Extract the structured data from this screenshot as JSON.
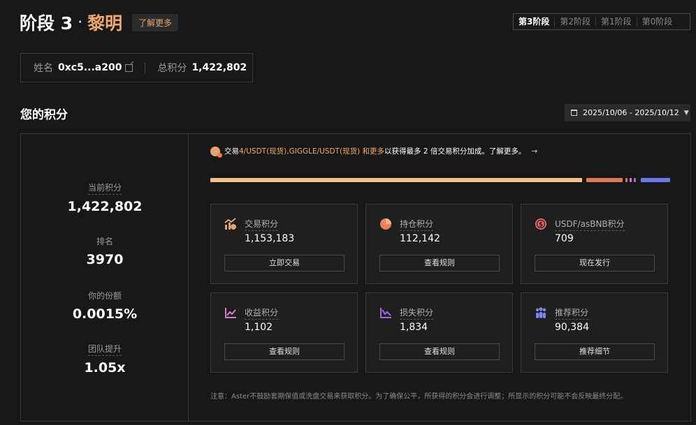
{
  "header": {
    "stage_title": "阶段 3",
    "dot": "·",
    "stage_name": "黎明",
    "learn_more": "了解更多",
    "stage_tabs": [
      "第3阶段",
      "第2阶段",
      "第1阶段",
      "第0阶段"
    ]
  },
  "user": {
    "name_label": "姓名",
    "name_value": "0xc5...a200",
    "total_label": "总积分",
    "total_value": "1,422,802"
  },
  "section": {
    "title": "您的积分",
    "date_range": "2025/10/06 - 2025/10/12"
  },
  "stats": [
    {
      "label": "当前积分",
      "value": "1,422,802"
    },
    {
      "label": "排名",
      "value": "3970"
    },
    {
      "label": "你的份额",
      "value": "0.0015%"
    },
    {
      "label": "团队提升",
      "value": "1.05x"
    }
  ],
  "promo": {
    "pre": "交易",
    "highlight": "4/USDT(现货),GIGGLE/USDT(现货) 和更多",
    "post": "以获得最多 2 倍交易积分加成。了解更多。",
    "arrow": "→"
  },
  "progress": {
    "segments": [
      {
        "name": "交易积分",
        "value": 1153183,
        "color": "#f2c08a"
      },
      {
        "name": "持仓积分",
        "value": 112142,
        "color": "#e0785a"
      },
      {
        "name": "USDF/asBNB积分",
        "value": 709,
        "color": "#e0785a"
      },
      {
        "name": "收益积分",
        "value": 1102,
        "color": "#d07ad0"
      },
      {
        "name": "损失积分",
        "value": 1834,
        "color": "#9a6ae0"
      },
      {
        "name": "推荐积分",
        "value": 90384,
        "color": "#6a7ae8"
      }
    ]
  },
  "cards": [
    {
      "label": "交易积分",
      "value": "1,153,183",
      "button": "立即交易",
      "icon": "trade-chart-icon",
      "color": "#e0a475"
    },
    {
      "label": "持仓积分",
      "value": "112,142",
      "button": "查看规则",
      "icon": "pie-chart-icon",
      "color": "#e8835f"
    },
    {
      "label": "USDF/asBNB积分",
      "value": "709",
      "button": "现在发行",
      "icon": "dollar-coin-icon",
      "color": "#e86a6a"
    },
    {
      "label": "收益积分",
      "value": "1,102",
      "button": "查看规则",
      "icon": "profit-chart-icon",
      "color": "#d07ad0"
    },
    {
      "label": "损失积分",
      "value": "1,834",
      "button": "查看规则",
      "icon": "loss-chart-icon",
      "color": "#9a6ae0"
    },
    {
      "label": "推荐积分",
      "value": "90,384",
      "button": "推荐细节",
      "icon": "people-icon",
      "color": "#7a8af0"
    }
  ],
  "note": "注意：Aster不鼓励套期保值或洗盘交易来获取积分。为了确保公平，所获得的积分会进行调整；所显示的积分可能不会反映最终分配。"
}
